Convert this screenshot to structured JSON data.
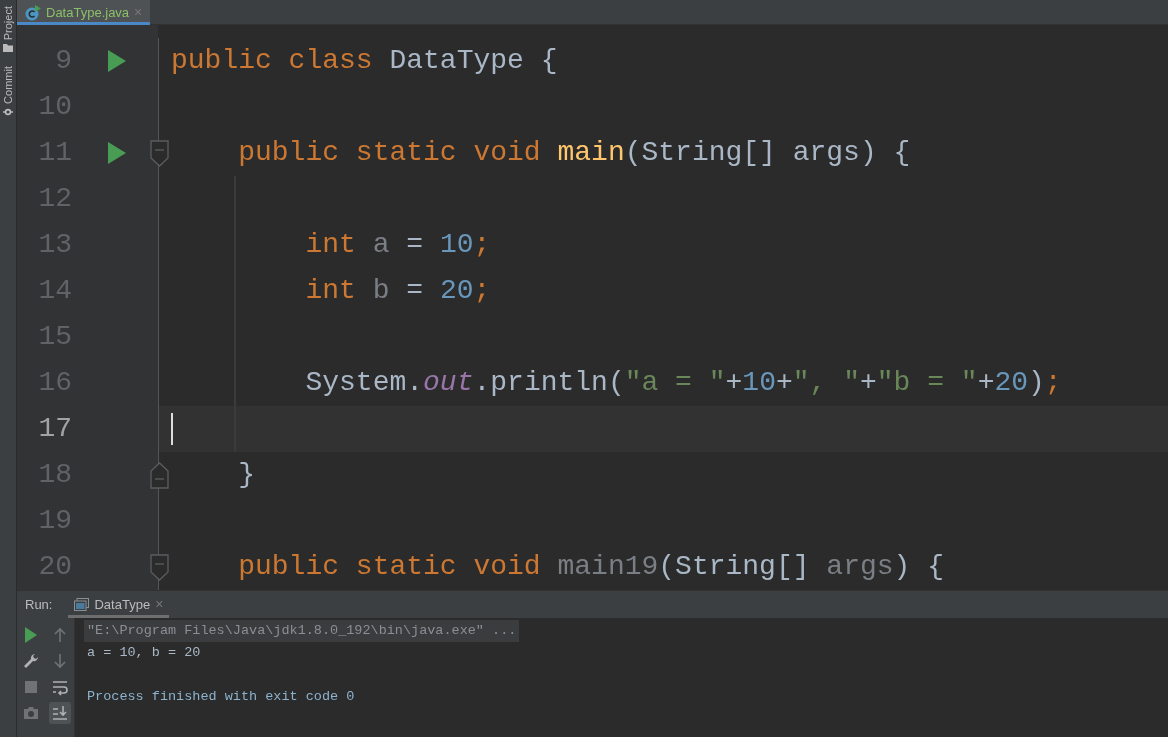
{
  "side_tools": [
    {
      "label": "Project",
      "kind": "folder"
    },
    {
      "label": "Commit",
      "kind": "commit"
    }
  ],
  "tabs": [
    {
      "label": "DataType.java",
      "close": "×",
      "selected": true
    }
  ],
  "lines": [
    {
      "number": "9",
      "run": true,
      "tokens": [
        {
          "kind": "keyword",
          "text": "public class "
        },
        {
          "kind": "plain",
          "text": "DataType {"
        }
      ]
    },
    {
      "number": "10"
    },
    {
      "number": "11",
      "run": true,
      "fold_start": true,
      "tokens": [
        {
          "kind": "keyword",
          "text": "    public static void "
        },
        {
          "kind": "method",
          "text": "main"
        },
        {
          "kind": "plain",
          "text": "(String[] args) {"
        }
      ]
    },
    {
      "number": "12"
    },
    {
      "number": "13",
      "tokens": [
        {
          "kind": "keyword",
          "text": "        int "
        },
        {
          "kind": "unused",
          "text": "a"
        },
        {
          "kind": "plain",
          "text": " = "
        },
        {
          "kind": "number",
          "text": "10"
        },
        {
          "kind": "keyword",
          "text": ";"
        }
      ]
    },
    {
      "number": "14",
      "tokens": [
        {
          "kind": "keyword",
          "text": "        int "
        },
        {
          "kind": "unused",
          "text": "b"
        },
        {
          "kind": "plain",
          "text": " = "
        },
        {
          "kind": "number",
          "text": "20"
        },
        {
          "kind": "keyword",
          "text": ";"
        }
      ]
    },
    {
      "number": "15"
    },
    {
      "number": "16",
      "tokens": [
        {
          "kind": "plain",
          "text": "        System."
        },
        {
          "kind": "field",
          "text": "out"
        },
        {
          "kind": "plain",
          "text": ".println("
        },
        {
          "kind": "string",
          "text": "\"a = \""
        },
        {
          "kind": "plain",
          "text": "+"
        },
        {
          "kind": "number",
          "text": "10"
        },
        {
          "kind": "plain",
          "text": "+"
        },
        {
          "kind": "string",
          "text": "\", \""
        },
        {
          "kind": "plain",
          "text": "+"
        },
        {
          "kind": "string",
          "text": "\"b = \""
        },
        {
          "kind": "plain",
          "text": "+"
        },
        {
          "kind": "number",
          "text": "20"
        },
        {
          "kind": "plain",
          "text": ")"
        },
        {
          "kind": "keyword",
          "text": ";"
        }
      ]
    },
    {
      "number": "17",
      "current": true
    },
    {
      "number": "18",
      "fold_end": true,
      "tokens": [
        {
          "kind": "plain",
          "text": "    }"
        }
      ]
    },
    {
      "number": "19"
    },
    {
      "number": "20",
      "fold_start": true,
      "tokens": [
        {
          "kind": "keyword",
          "text": "    public static void "
        },
        {
          "kind": "unused",
          "text": "main19"
        },
        {
          "kind": "plain",
          "text": "(String[] "
        },
        {
          "kind": "unused",
          "text": "args"
        },
        {
          "kind": "plain",
          "text": ") {"
        }
      ]
    }
  ],
  "run_panel": {
    "label": "Run:",
    "tab": {
      "label": "DataType",
      "close": "×",
      "selected": true
    },
    "tools_left": [
      {
        "kind": "rerun"
      },
      {
        "kind": "wrench"
      },
      {
        "kind": "stop",
        "disabled": true
      },
      {
        "kind": "camera",
        "disabled": true
      }
    ],
    "tools_right": [
      {
        "kind": "up",
        "disabled": true
      },
      {
        "kind": "down",
        "disabled": true
      },
      {
        "kind": "wrap"
      },
      {
        "kind": "scroll-end",
        "selected": true
      }
    ],
    "console": [
      {
        "kind": "command",
        "text": "\"E:\\Program Files\\Java\\jdk1.8.0_192\\bin\\java.exe\" ..."
      },
      {
        "kind": "output",
        "text": "a = 10, b = 20"
      },
      {
        "kind": "info",
        "text": "Process finished with exit code 0"
      }
    ]
  }
}
